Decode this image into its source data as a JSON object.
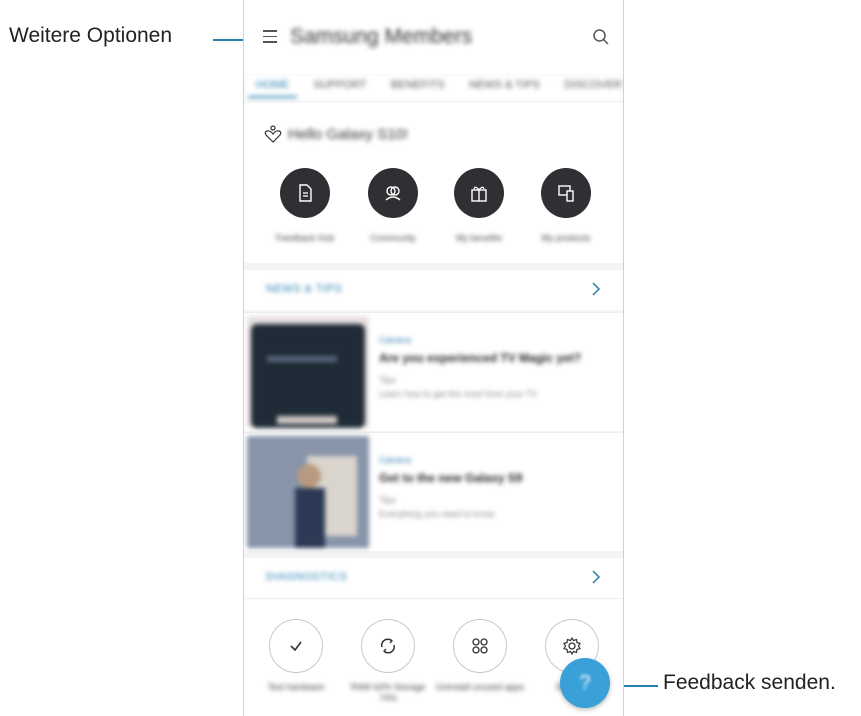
{
  "callouts": {
    "more_options": "Weitere Optionen",
    "send_feedback": "Feedback senden."
  },
  "app": {
    "title": "Samsung Members",
    "tabs": [
      "HOME",
      "SUPPORT",
      "BENEFITS",
      "NEWS & TIPS",
      "DISCOVER"
    ],
    "greeting": "Hello Galaxy S10!",
    "actions": [
      {
        "label": "Feedback Hub",
        "icon": "document-icon"
      },
      {
        "label": "Community",
        "icon": "people-icon"
      },
      {
        "label": "My benefits",
        "icon": "gift-icon"
      },
      {
        "label": "My products",
        "icon": "devices-icon"
      }
    ],
    "news_header": "NEWS & TIPS",
    "articles": [
      {
        "category": "Camera",
        "title": "Are you experienced TV Magic yet?",
        "meta": "Tips",
        "meta2": "Learn how to get the most from your TV"
      },
      {
        "category": "Camera",
        "title": "Get to the new Galaxy S9",
        "meta": "Tips",
        "meta2": "Everything you need to know"
      }
    ],
    "diagnostics_header": "DIAGNOSTICS",
    "diagnostics": [
      {
        "label": "Test hardware",
        "icon": "check-icon"
      },
      {
        "label": "RAM 64% Storage 74%",
        "icon": "refresh-icon"
      },
      {
        "label": "Uninstall unused apps",
        "icon": "apps-icon"
      },
      {
        "label": "Settings",
        "icon": "gear-icon"
      }
    ],
    "fab_label": "?"
  },
  "colors": {
    "accent": "#2a7fb0",
    "fab": "#3aa0d8",
    "dark_button": "#2f3033"
  }
}
